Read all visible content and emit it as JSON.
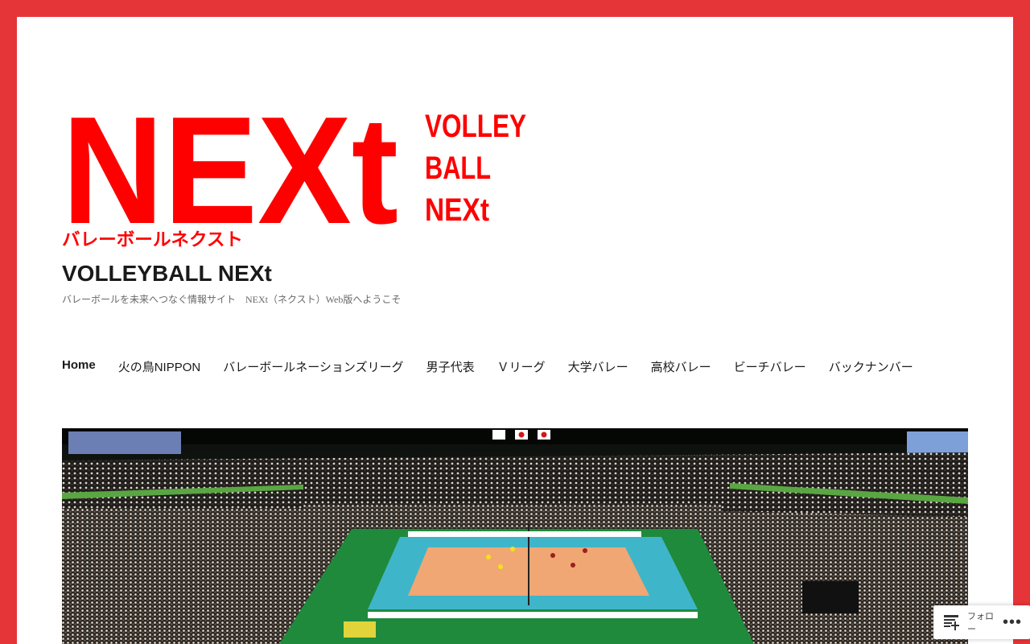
{
  "brand": {
    "logo_big": "NEXt",
    "logo_side_lines": [
      "VOLLEY",
      "BALL",
      "NEXt"
    ],
    "logo_kana": "バレーボールネクスト",
    "accent": "#ff0000",
    "border": "#e63539"
  },
  "site": {
    "title": "VOLLEYBALL NEXt",
    "tagline": "バレーボールを未来へつなぐ情報サイト　NEXt（ネクスト）Web版へようこそ"
  },
  "nav": {
    "items": [
      {
        "label": "Home"
      },
      {
        "label": "火の鳥NIPPON"
      },
      {
        "label": "バレーボールネーションズリーグ"
      },
      {
        "label": "男子代表"
      },
      {
        "label": "Ｖリーグ"
      },
      {
        "label": "大学バレー"
      },
      {
        "label": "高校バレー"
      },
      {
        "label": "ビーチバレー"
      },
      {
        "label": "バックナンバー"
      }
    ]
  },
  "hero": {
    "icon": "arena-photo"
  },
  "actionbar": {
    "reader_icon": "reader-icon",
    "label": "フォロー",
    "more": "•••"
  }
}
